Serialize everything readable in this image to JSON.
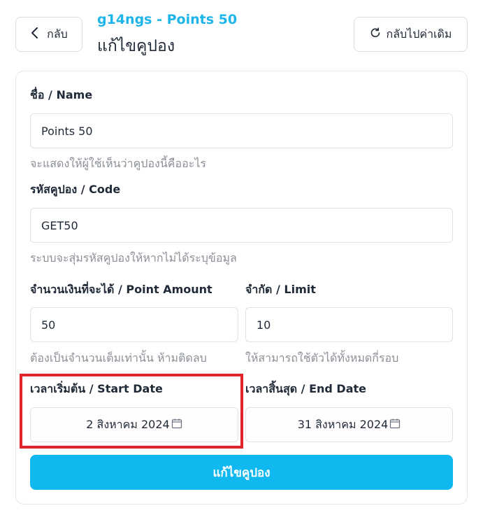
{
  "header": {
    "back_label": "กลับ",
    "subtitle": "g14ngs - Points 50",
    "title": "แก้ไขคูปอง",
    "reset_label": "กลับไปค่าเดิม"
  },
  "form": {
    "name": {
      "label": "ชื่อ / Name",
      "value": "Points 50",
      "hint": "จะแสดงให้ผู้ใช้เห็นว่าคูปองนี้คืออะไร"
    },
    "code": {
      "label": "รหัสคูปอง / Code",
      "value": "GET50",
      "hint": "ระบบจะสุ่มรหัสคูปองให้หากไม่ได้ระบุข้อมูล"
    },
    "point_amount": {
      "label": "จำนวนเงินที่จะได้ / Point Amount",
      "value": "50",
      "hint": "ต้องเป็นจำนวนเต็มเท่านั้น ห้ามติดลบ"
    },
    "limit": {
      "label": "จำกัด / Limit",
      "value": "10",
      "hint": "ให้สามารถใช้ตัวได้ทั้งหมดกี่รอบ"
    },
    "start_date": {
      "label": "เวลาเริ่มต้น / Start Date",
      "value": "2 สิงหาคม 2024"
    },
    "end_date": {
      "label": "เวลาสิ้นสุด / End Date",
      "value": "31 สิงหาคม 2024"
    },
    "submit_label": "แก้ไขคูปอง"
  },
  "colors": {
    "accent": "#10b8f0",
    "subtitle": "#1eb6ea",
    "highlight": "#e0242b"
  },
  "icons": {
    "back": "chevron-left-icon",
    "reset": "refresh-icon",
    "date": "calendar-icon"
  }
}
